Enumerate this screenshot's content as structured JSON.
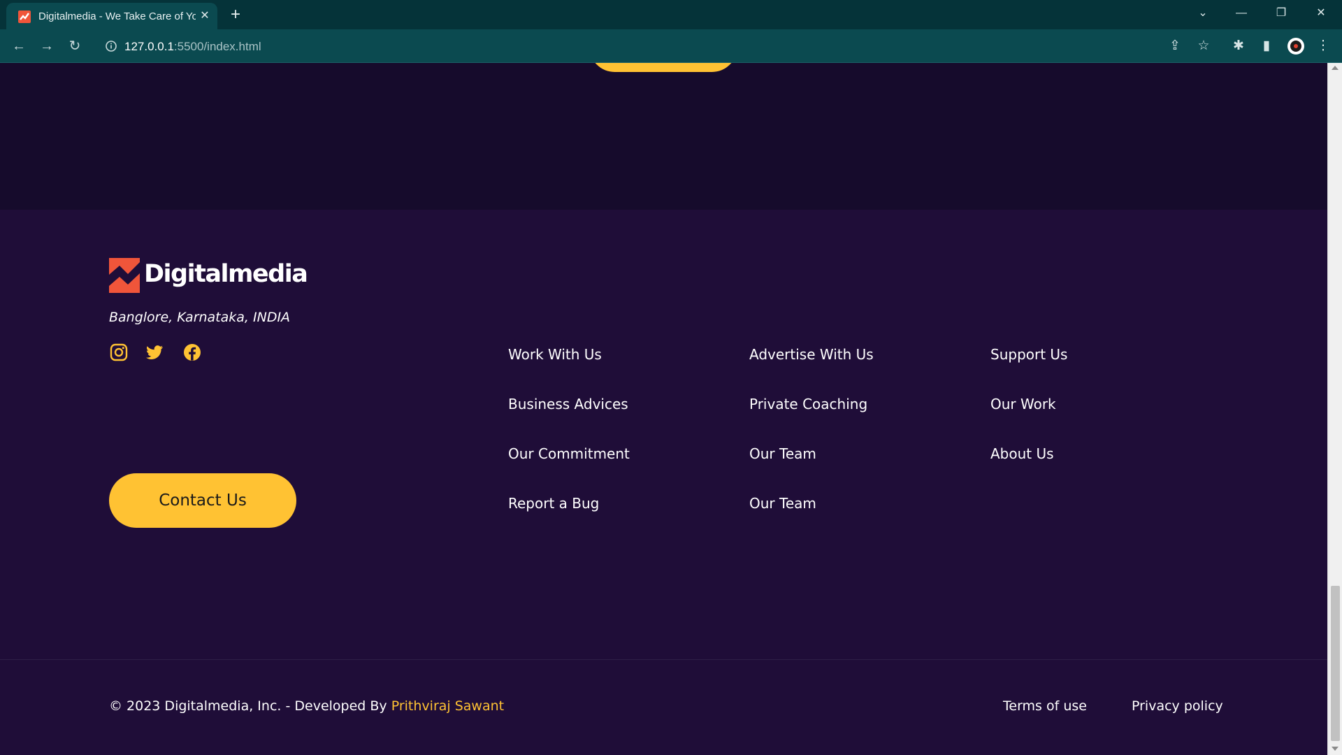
{
  "browser": {
    "tab_title": "Digitalmedia - We Take Care of Your",
    "new_tab_icon": "plus-icon",
    "url_host": "127.0.0.1",
    "url_rest": ":5500/index.html",
    "window_controls": [
      "chevron-down-icon",
      "minimize-icon",
      "restore-icon",
      "close-icon"
    ],
    "toolbar_icons": [
      "share-icon",
      "star-icon",
      "extensions-icon",
      "side-panel-icon",
      "profile-icon",
      "kebab-menu-icon"
    ]
  },
  "brand": {
    "name": "Digitalmedia",
    "location": "Banglore, Karnataka, INDIA",
    "logo_color": "#f0553a"
  },
  "social": [
    "instagram-icon",
    "twitter-icon",
    "facebook-icon"
  ],
  "contact_button": "Contact Us",
  "footer_columns": [
    [
      "Work With Us",
      "Business Advices",
      "Our Commitment",
      "Report a Bug"
    ],
    [
      "Advertise With Us",
      "Private Coaching",
      "Our Team",
      "Our Team"
    ],
    [
      "Support Us",
      "Our Work",
      "About Us"
    ]
  ],
  "copyright": {
    "text": "© 2023 Digitalmedia, Inc. - Developed By ",
    "author": "Prithviraj Sawant"
  },
  "legal": {
    "terms": "Terms of use",
    "privacy": "Privacy policy"
  },
  "colors": {
    "accent": "#ffc233",
    "page_top_bg": "#160b2c",
    "footer_bg": "#1f0d38",
    "chrome_bg": "#0b4a50"
  }
}
